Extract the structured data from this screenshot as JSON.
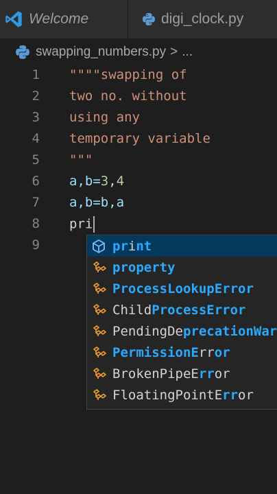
{
  "tabs": [
    {
      "label": "Welcome",
      "icon": "vscode-logo-icon"
    },
    {
      "label": "digi_clock.py",
      "icon": "python-file-icon"
    }
  ],
  "breadcrumb": {
    "file": "swapping_numbers.py",
    "separator": ">",
    "more": "..."
  },
  "code_lines": [
    {
      "number": "1",
      "text": "\"\"\"\"swapping of"
    },
    {
      "number": "2",
      "text": "two no. without"
    },
    {
      "number": "3",
      "text": "using any"
    },
    {
      "number": "4",
      "text": "temporary variable"
    },
    {
      "number": "5",
      "text": "\"\"\""
    },
    {
      "number": "6",
      "parts": [
        "a,b=",
        "3",
        ",",
        "4"
      ]
    },
    {
      "number": "7",
      "text": "a,b=b,a"
    },
    {
      "number": "8",
      "text": "pri"
    },
    {
      "number": "9",
      "text": ""
    }
  ],
  "suggestions": [
    {
      "parts": [
        "",
        "pr",
        "i",
        "nt"
      ],
      "icon": "method-cube-icon",
      "selected": true
    },
    {
      "parts": [
        "",
        "pr",
        "",
        "operty"
      ],
      "icon": "class-icon"
    },
    {
      "parts": [
        "",
        "Pr",
        "",
        "ocessLookupError"
      ],
      "icon": "class-icon"
    },
    {
      "parts": [
        "Child",
        "Pr",
        "",
        "ocessError"
      ],
      "icon": "class-icon"
    },
    {
      "parts": [
        "PendingDe",
        "pr",
        "",
        "ecationWarning"
      ],
      "icon": "class-icon"
    },
    {
      "parts": [
        "",
        "P",
        "",
        "ermissionE",
        "rr",
        "or"
      ],
      "icon": "class-icon"
    },
    {
      "parts": [
        "BrokenPipeE",
        "rr",
        "or"
      ],
      "icon": "class-icon"
    },
    {
      "parts": [
        "FloatingPointE",
        "rr",
        "or"
      ],
      "icon": "class-icon"
    }
  ],
  "colors": {
    "string": "#ce9178",
    "variable": "#9cdcfe",
    "number": "#b5cea8",
    "match_highlight": "#2aaaff",
    "selected_bg": "#04395e",
    "class_icon": "#ee9d28",
    "method_icon": "#75beff"
  }
}
